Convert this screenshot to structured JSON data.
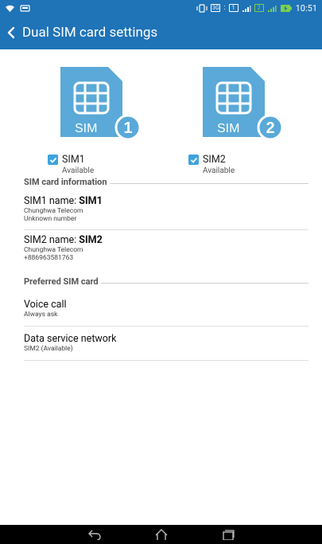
{
  "statusbar": {
    "sim1_badge": "1",
    "sim2_badge": "2",
    "network_badge": "3G",
    "time": "10:51"
  },
  "appbar": {
    "title": "Dual SIM card settings"
  },
  "sims": [
    {
      "badge_number": "1",
      "card_text": "SIM",
      "label": "SIM1",
      "status": "Available",
      "checked": true
    },
    {
      "badge_number": "2",
      "card_text": "SIM",
      "label": "SIM2",
      "status": "Available",
      "checked": true
    }
  ],
  "sim_info": {
    "header": "SIM card information",
    "sim1": {
      "name_prefix": "SIM1 name: ",
      "name": "SIM1",
      "carrier": "Chunghwa Telecom",
      "number": "Unknown number"
    },
    "sim2": {
      "name_prefix": "SIM2 name: ",
      "name": "SIM2",
      "carrier": "Chunghwa Telecom",
      "number": "+886963581763"
    }
  },
  "preferred": {
    "header": "Preferred SIM card",
    "voice_call": {
      "title": "Voice call",
      "value": "Always ask"
    },
    "data_network": {
      "title": "Data service network",
      "value": "SIM2 (Available)"
    }
  },
  "colors": {
    "accent": "#1f73b7",
    "sim_icon": "#5aa9d8",
    "checkbox": "#3ea3dc"
  },
  "icons": {
    "back": "chevron-left-icon",
    "sim": "sim-card-icon",
    "nav_back": "back-arrow-icon",
    "nav_home": "home-icon",
    "nav_recents": "recent-apps-icon"
  }
}
